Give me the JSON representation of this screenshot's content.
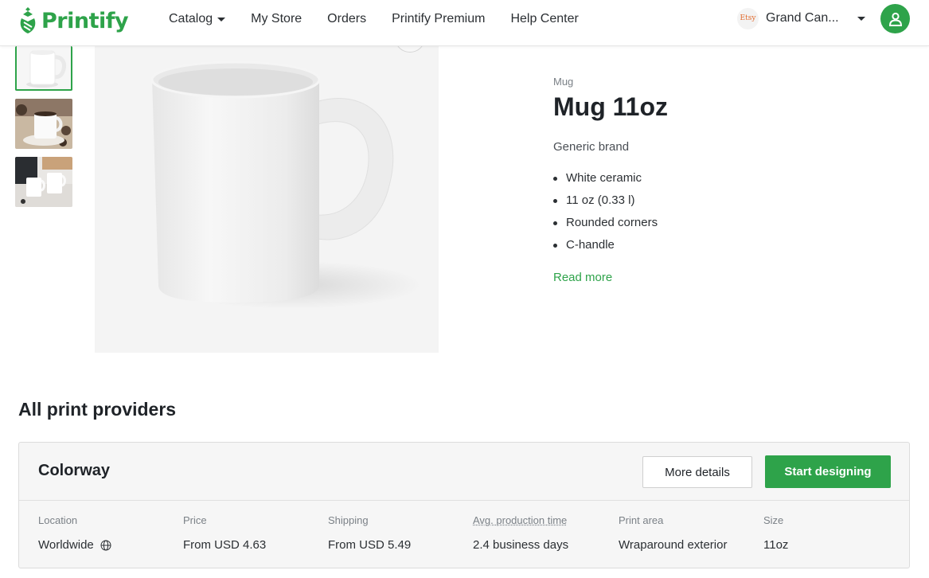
{
  "header": {
    "logo_text": "Printify",
    "nav": [
      {
        "label": "Catalog",
        "has_dropdown": true
      },
      {
        "label": "My Store",
        "has_dropdown": false
      },
      {
        "label": "Orders",
        "has_dropdown": false
      },
      {
        "label": "Printify Premium",
        "has_dropdown": false
      },
      {
        "label": "Help Center",
        "has_dropdown": false
      }
    ],
    "store": {
      "badge_text": "Etsy",
      "name": "Grand Can..."
    },
    "avatar_icon": "user-icon"
  },
  "gallery": {
    "thumbnails": [
      "mug-white-plain",
      "mug-table-scene",
      "mug-pair-scene"
    ],
    "selected_index": 0
  },
  "product": {
    "category": "Mug",
    "title": "Mug 11oz",
    "brand": "Generic brand",
    "features": [
      "White ceramic",
      "11 oz (0.33 l)",
      "Rounded corners",
      "C-handle"
    ],
    "read_more": "Read more"
  },
  "providers": {
    "title": "All print providers",
    "items": [
      {
        "name": "Colorway",
        "more_details_label": "More details",
        "start_designing_label": "Start designing",
        "specs": [
          {
            "label": "Location",
            "value": "Worldwide",
            "icon": "globe-icon"
          },
          {
            "label": "Price",
            "value": "From USD 4.63"
          },
          {
            "label": "Shipping",
            "value": "From USD 5.49"
          },
          {
            "label": "Avg. production time",
            "value": "2.4 business days"
          },
          {
            "label": "Print area",
            "value": "Wraparound exterior"
          },
          {
            "label": "Size",
            "value": "11oz"
          }
        ]
      }
    ]
  },
  "colors": {
    "brand_green": "#2ea34a",
    "text_dark": "#1f2328",
    "text_muted": "#7b8187"
  }
}
